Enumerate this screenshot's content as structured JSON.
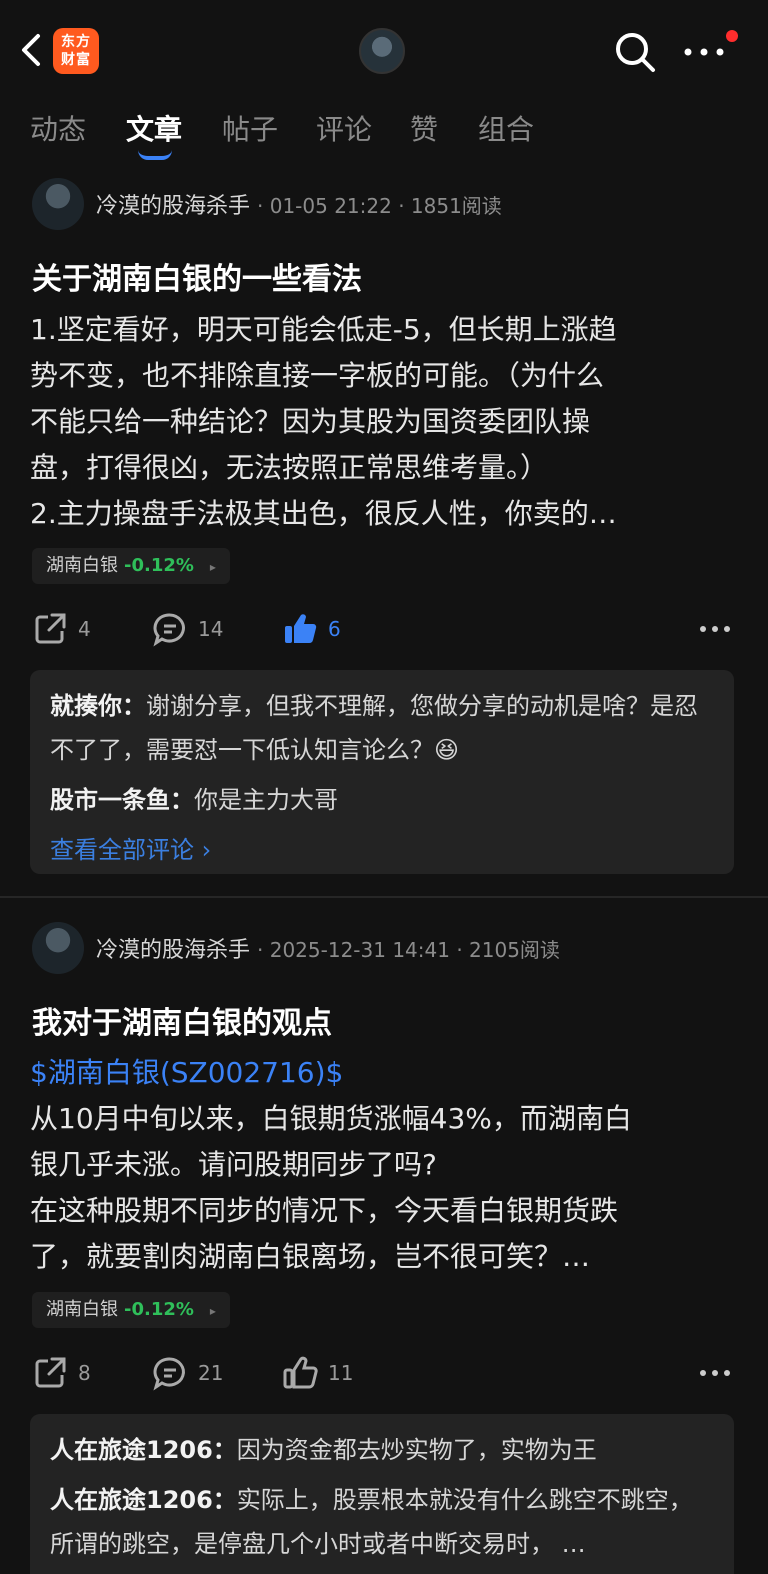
{
  "header": {
    "logo_line1": "东方",
    "logo_line2": "财富",
    "icons": [
      "back-icon",
      "search-icon",
      "more-icon"
    ],
    "notification_dot_color": "#ff2d2d"
  },
  "tabs": [
    {
      "label": "动态",
      "active": false
    },
    {
      "label": "文章",
      "active": true
    },
    {
      "label": "帖子",
      "active": false
    },
    {
      "label": "评论",
      "active": false
    },
    {
      "label": "赞",
      "active": false
    },
    {
      "label": "组合",
      "active": false
    }
  ],
  "posts": [
    {
      "author": "冷漠的股海杀手",
      "meta": "· 01-05 21:22 · 1851阅读",
      "title": "关于湖南白银的一些看法",
      "body": [
        "1.坚定看好，明天可能会低走-5，但长期上涨趋",
        "势不变，也不排除直接一字板的可能。（为什么",
        "不能只给一种结论？因为其股为国资委团队操",
        "盘，打得很凶，无法按照正常思维考量。）",
        "2.主力操盘手法极其出色，很反人性，你卖的…"
      ],
      "stock": {
        "name": "湖南白银",
        "change": "-0.12%"
      },
      "shares": "4",
      "comments_count": "14",
      "likes": "6",
      "liked": true,
      "comments": [
        {
          "user": "就揍你：",
          "text": "谢谢分享，但我不理解，您做分享的动机是啥？是忍不了了，需要怼一下低认知言论么？😆"
        },
        {
          "user": "股市一条鱼：",
          "text": "你是主力大哥"
        }
      ],
      "view_all": "查看全部评论 ›"
    },
    {
      "author": "冷漠的股海杀手",
      "meta": "· 2025-12-31 14:41 · 2105阅读",
      "title": "我对于湖南白银的观点",
      "link": "$湖南白银(SZ002716)$",
      "body": [
        "从10月中旬以来，白银期货涨幅43%，而湖南白",
        "银几乎未涨。请问股期同步了吗?",
        "在这种股期不同步的情况下，今天看白银期货跌",
        "了，就要割肉湖南白银离场，岂不很可笑？…"
      ],
      "stock": {
        "name": "湖南白银",
        "change": "-0.12%"
      },
      "shares": "8",
      "comments_count": "21",
      "likes": "11",
      "liked": false,
      "comments": [
        {
          "user": "人在旅途1206：",
          "text": "因为资金都去炒实物了，实物为王"
        },
        {
          "user": "人在旅途1206：",
          "text": "实际上，股票根本就没有什么跳空不跳空，  所谓的跳空，是停盘几个小时或者中断交易时，  …"
        }
      ]
    }
  ]
}
